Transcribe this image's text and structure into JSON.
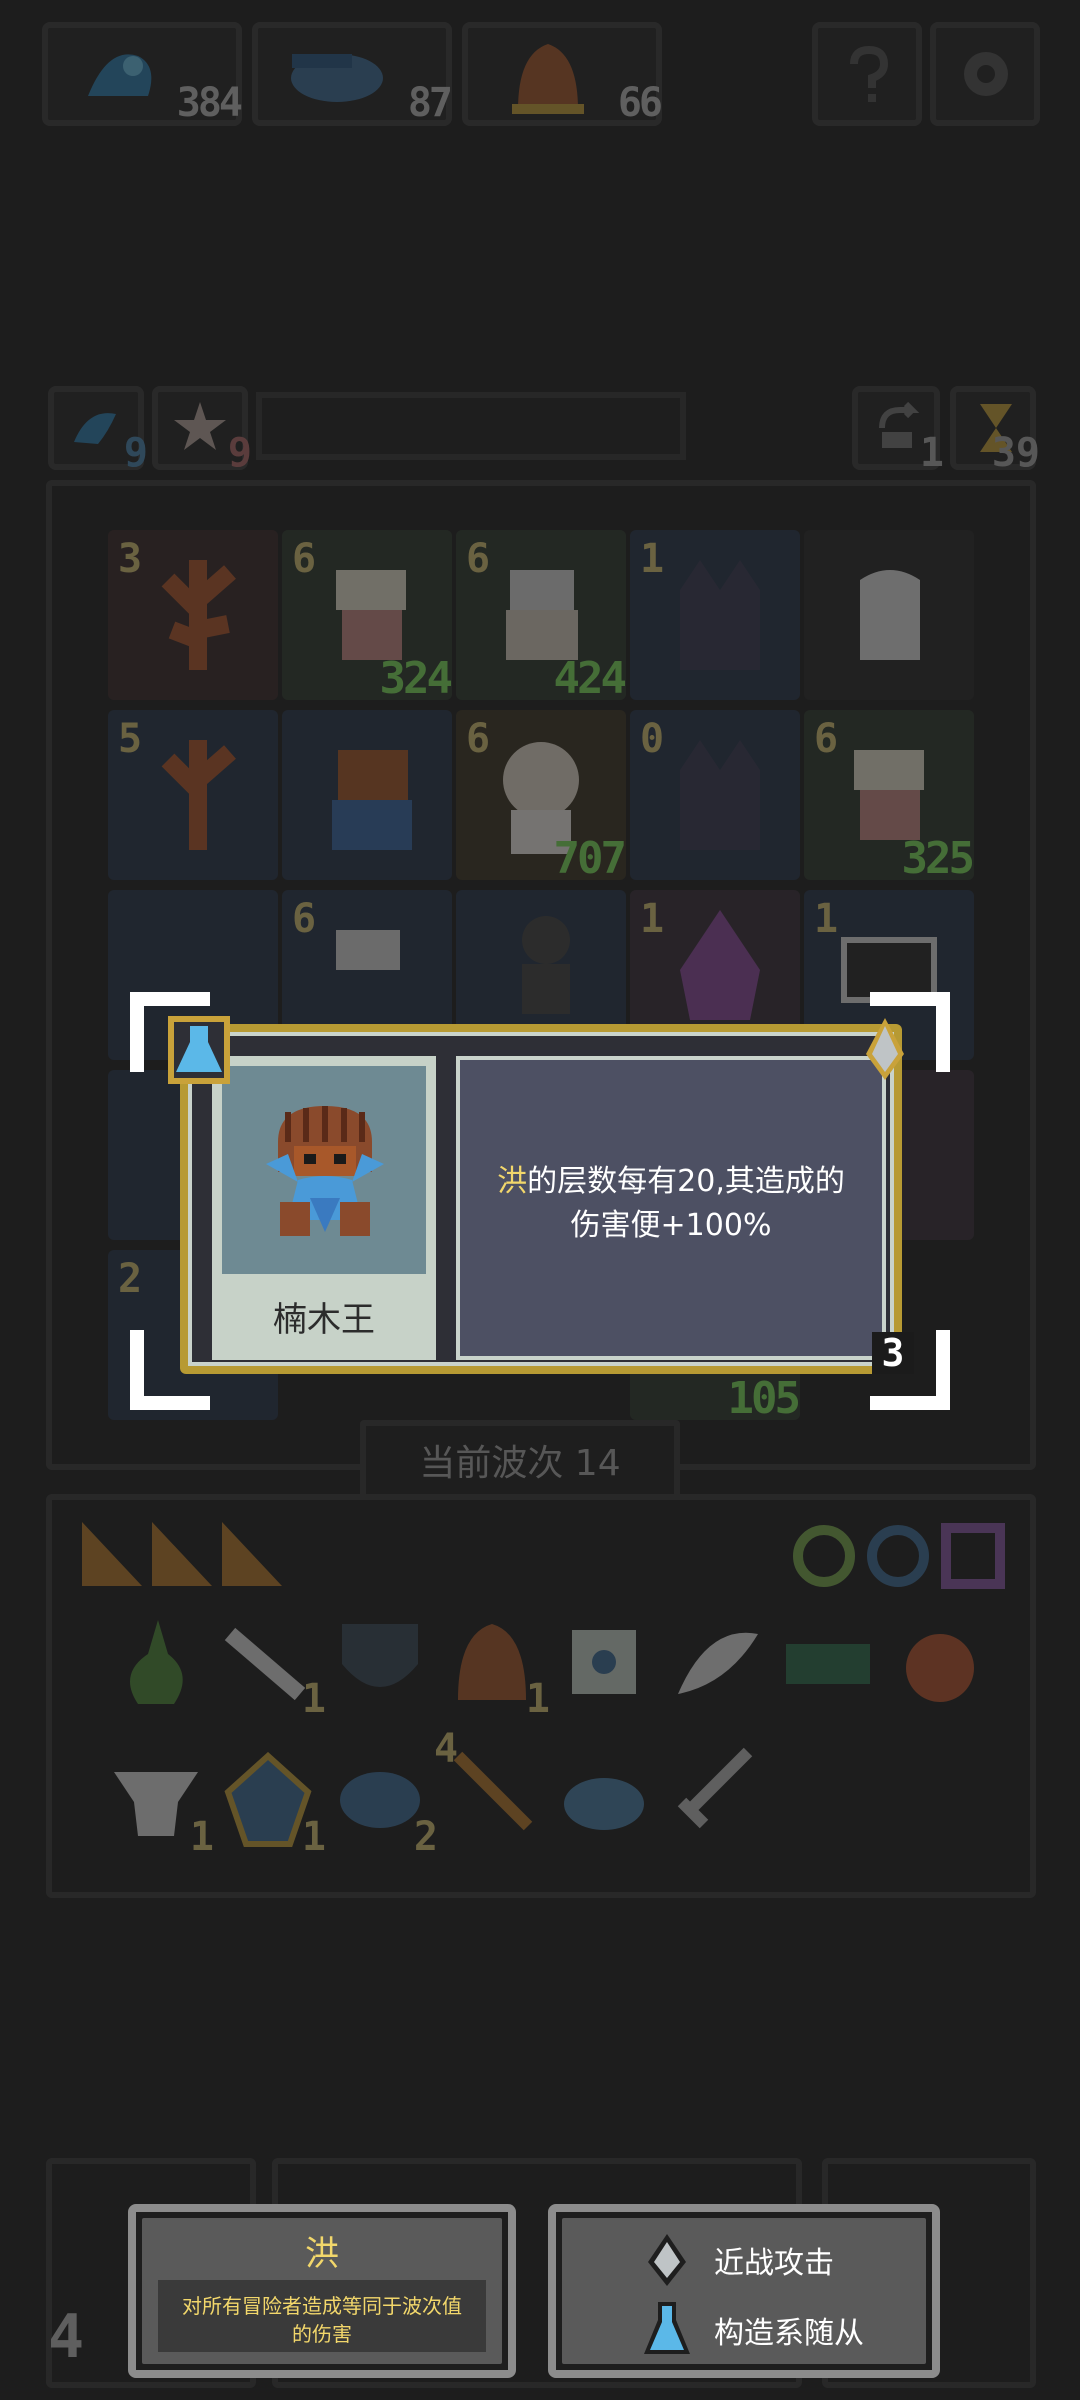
{
  "resources": [
    {
      "name": "blue-essence-icon",
      "value": "384"
    },
    {
      "name": "fish-icon",
      "value": "87"
    },
    {
      "name": "bell-icon",
      "value": "66"
    }
  ],
  "top_right_buttons": [
    "help-icon",
    "settings-icon"
  ],
  "buffs": [
    {
      "name": "blue-buff-icon",
      "count": "9"
    },
    {
      "name": "star-buff-icon",
      "count": "9"
    }
  ],
  "counters": [
    {
      "name": "refresh-icon",
      "value": "1"
    },
    {
      "name": "hourglass-icon",
      "value": "39"
    }
  ],
  "board": {
    "row1": [
      {
        "level": "3",
        "hp": ""
      },
      {
        "level": "6",
        "hp": "324"
      },
      {
        "level": "6",
        "hp": "424"
      },
      {
        "level": "1",
        "hp": ""
      },
      {
        "level": "",
        "hp": ""
      }
    ],
    "row2": [
      {
        "level": "5",
        "hp": ""
      },
      {
        "level": "",
        "hp": ""
      },
      {
        "level": "6",
        "hp": "707"
      },
      {
        "level": "0",
        "hp": ""
      },
      {
        "level": "6",
        "hp": "325"
      }
    ],
    "row3": [
      {
        "level": "",
        "hp": ""
      },
      {
        "level": "6",
        "hp": ""
      },
      {
        "level": "",
        "hp": ""
      },
      {
        "level": "1",
        "hp": ""
      },
      {
        "level": "1",
        "hp": ""
      }
    ],
    "row5": [
      {
        "level": "2",
        "hp": ""
      },
      {
        "level": "",
        "hp": ""
      },
      {
        "level": "",
        "hp": ""
      },
      {
        "level": "",
        "hp": "105"
      },
      {
        "level": "",
        "hp": ""
      }
    ]
  },
  "wave_label": "当前波次 14",
  "inventory_counts": {
    "claw": "1",
    "helmet": "1",
    "anvil": "1",
    "crystal": "1",
    "fish_hat": "2",
    "wand": "4"
  },
  "dialog": {
    "unit_name": "楠木王",
    "keyword": "洪",
    "desc_line1_rest": "的层数每有20,其造成的",
    "desc_line2": "伤害便+100%",
    "stack_count": "3"
  },
  "tooltip_left": {
    "title": "洪",
    "body": "对所有冒险者造成等同于波次值的伤害"
  },
  "tooltip_right": {
    "tag1": "近战攻击",
    "tag2": "构造系随从"
  },
  "bottom_left_number": "4",
  "colors": {
    "keyword": "#f2d76b",
    "card_border": "#b79a33",
    "hp_green": "#7fe05e"
  }
}
